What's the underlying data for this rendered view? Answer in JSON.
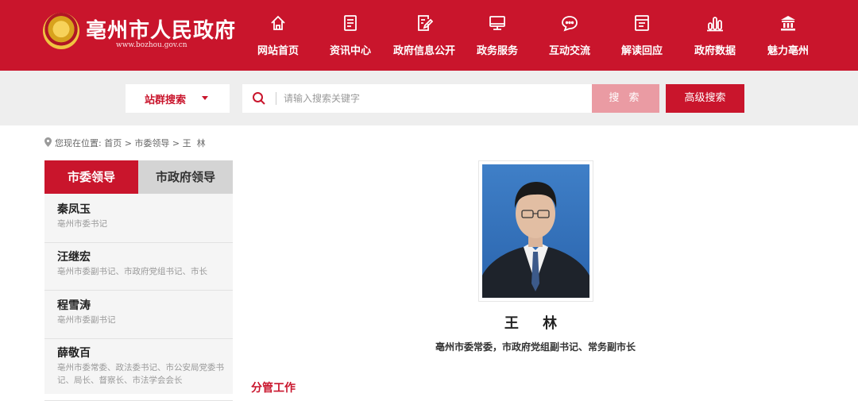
{
  "header": {
    "site_name": "亳州市人民政府",
    "site_url": "www.bozhou.gov.cn",
    "nav": [
      {
        "label": "网站首页",
        "icon": "home-icon"
      },
      {
        "label": "资讯中心",
        "icon": "document-icon"
      },
      {
        "label": "政府信息公开",
        "icon": "edit-document-icon"
      },
      {
        "label": "政务服务",
        "icon": "monitor-icon"
      },
      {
        "label": "互动交流",
        "icon": "chat-icon"
      },
      {
        "label": "解读回应",
        "icon": "file-icon"
      },
      {
        "label": "政府数据",
        "icon": "bar-chart-icon"
      },
      {
        "label": "魅力亳州",
        "icon": "landmark-icon"
      }
    ]
  },
  "search": {
    "scope_label": "站群搜索",
    "placeholder": "请输入搜索关键字",
    "search_button": "搜 索",
    "advanced_button": "高级搜索"
  },
  "breadcrumb": {
    "prefix": "您现在位置: ",
    "items": [
      "首页",
      "市委领导",
      "王  林"
    ],
    "separator": " > "
  },
  "sidebar": {
    "tabs": [
      "市委领导",
      "市政府领导"
    ],
    "leaders": [
      {
        "name": "秦凤玉",
        "title": "亳州市委书记"
      },
      {
        "name": "汪继宏",
        "title": "亳州市委副书记、市政府党组书记、市长"
      },
      {
        "name": "程雪涛",
        "title": "亳州市委副书记"
      },
      {
        "name": "薛敬百",
        "title": "亳州市委常委、政法委书记、市公安局党委书记、局长、督察长、市法学会会长"
      }
    ]
  },
  "profile": {
    "name": "王 林",
    "title": "亳州市委常委，市政府党组副书记、常务副市长",
    "section_heading": "分管工作"
  },
  "colors": {
    "brand_red": "#c9152c",
    "search_button": "#ea9ba3",
    "band_gray": "#eeeeee"
  }
}
